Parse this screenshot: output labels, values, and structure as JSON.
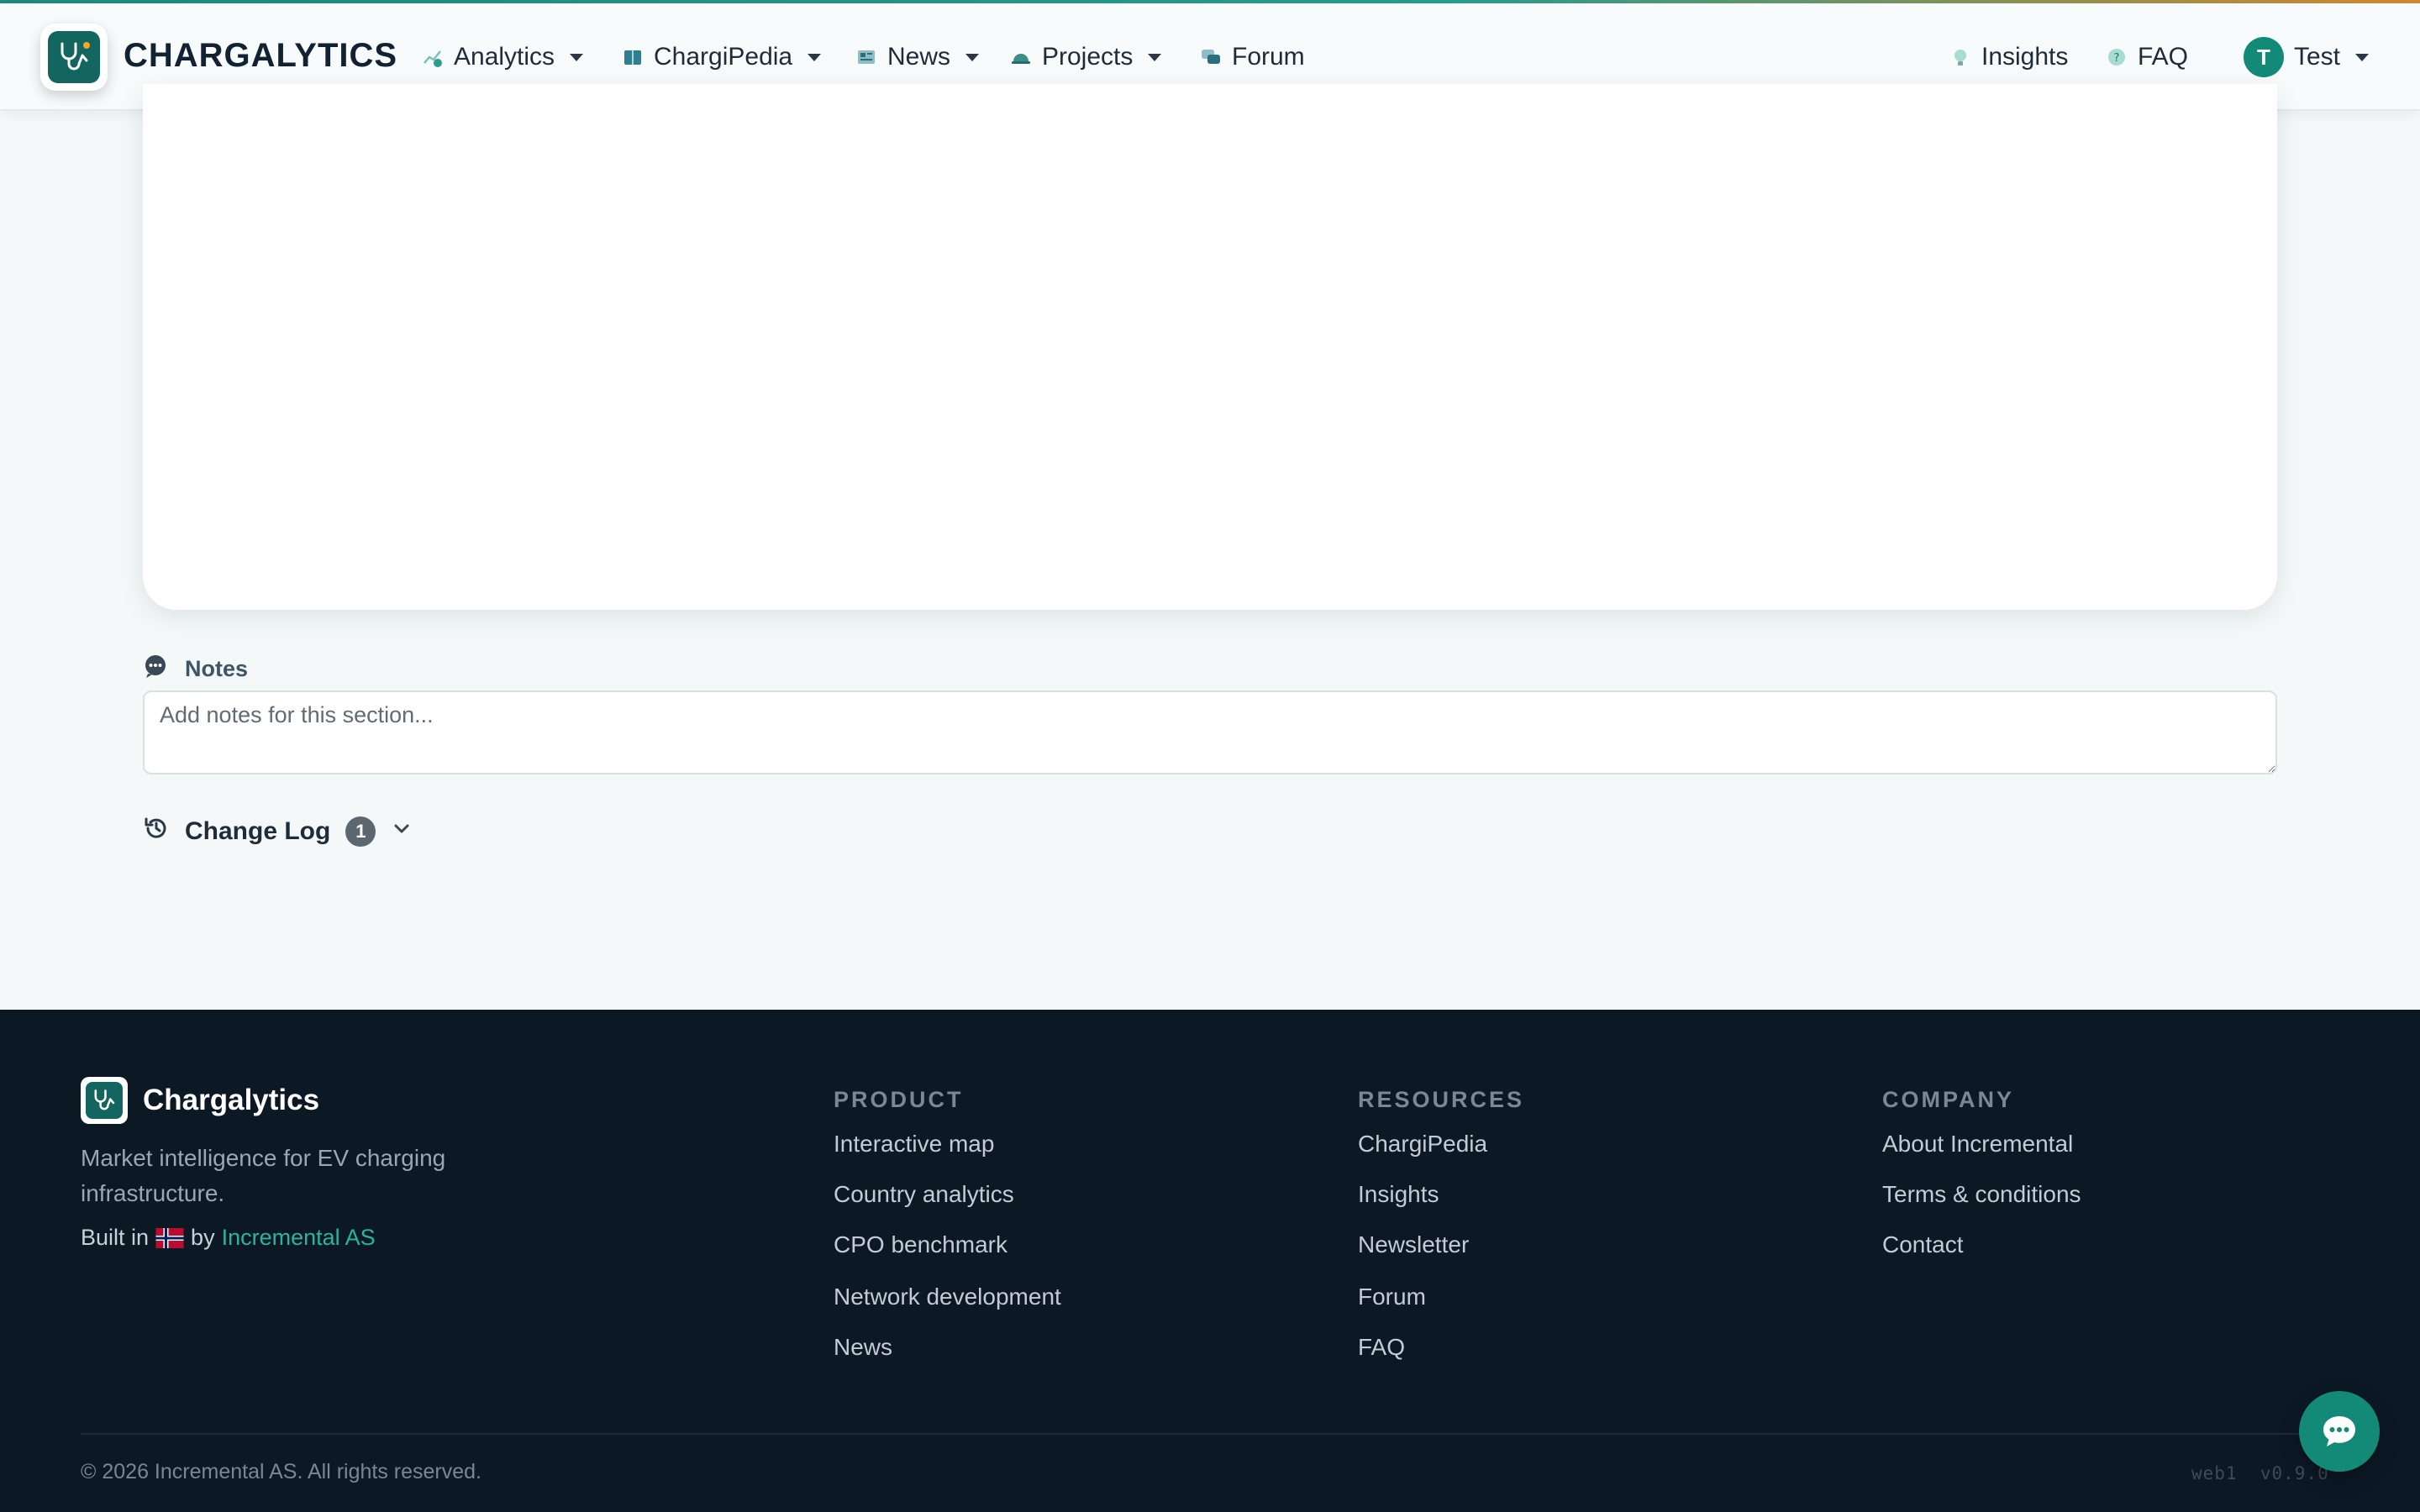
{
  "navbar": {
    "brand": "CHARGALYTICS",
    "items": [
      {
        "label": "Analytics",
        "icon": "chart-growth-icon",
        "dropdown": true
      },
      {
        "label": "ChargiPedia",
        "icon": "book-icon",
        "dropdown": true
      },
      {
        "label": "News",
        "icon": "newspaper-icon",
        "dropdown": true
      },
      {
        "label": "Projects",
        "icon": "hardhat-icon",
        "dropdown": true
      },
      {
        "label": "Forum",
        "icon": "chat-bubbles-icon",
        "dropdown": false
      }
    ],
    "right": {
      "insights": "Insights",
      "faq": "FAQ",
      "user_initial": "T",
      "user_name": "Test"
    }
  },
  "notes": {
    "label": "Notes",
    "placeholder": "Add notes for this section..."
  },
  "changelog": {
    "label": "Change Log",
    "count": "1"
  },
  "footer": {
    "brand": "Chargalytics",
    "tagline": "Market intelligence for EV charging infrastructure.",
    "built_prefix": "Built in",
    "built_by": "by",
    "company_link": "Incremental AS",
    "columns": [
      {
        "title": "PRODUCT",
        "links": [
          "Interactive map",
          "Country analytics",
          "CPO benchmark",
          "Network development",
          "News"
        ]
      },
      {
        "title": "RESOURCES",
        "links": [
          "ChargiPedia",
          "Insights",
          "Newsletter",
          "Forum",
          "FAQ"
        ]
      },
      {
        "title": "COMPANY",
        "links": [
          "About Incremental",
          "Terms & conditions",
          "Contact"
        ]
      }
    ],
    "copyright": "© 2026 Incremental AS. All rights reserved.",
    "server": "web1",
    "version": "v0.9.0"
  },
  "colors": {
    "accent": "#138a77",
    "footer_bg": "#0c1925",
    "page_bg": "#f4f8f8"
  }
}
